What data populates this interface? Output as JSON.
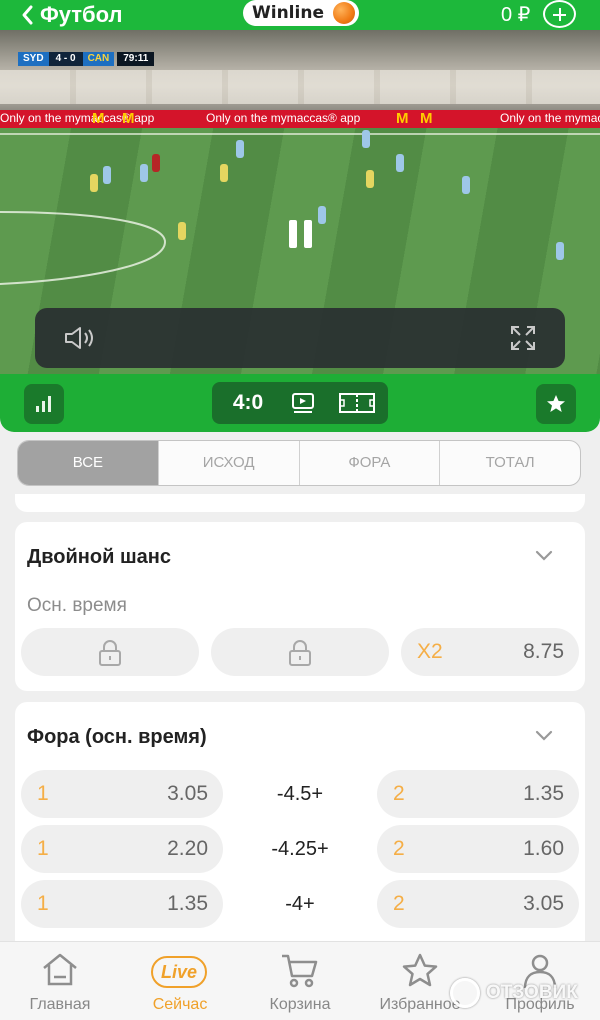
{
  "header": {
    "title": "Футбол",
    "logo_text": "Winline",
    "balance": "0 ₽"
  },
  "video": {
    "scoreboard": {
      "team_home": "SYD",
      "score": "4 - 0",
      "team_away": "CAN",
      "clock": "79:11"
    },
    "ads": [
      "Only on the mymaccas® app",
      "Only on the mymaccas® app",
      "Only on the mymaccas® app"
    ]
  },
  "match_bar": {
    "score": "4:0"
  },
  "tabs": [
    {
      "label": "ВСЕ",
      "active": true
    },
    {
      "label": "ИСХОД",
      "active": false
    },
    {
      "label": "ФОРА",
      "active": false
    },
    {
      "label": "ТОТАЛ",
      "active": false
    }
  ],
  "double_chance": {
    "title": "Двойной шанс",
    "subtitle": "Осн. время",
    "option3_label": "X2",
    "option3_odds": "8.75"
  },
  "handicap": {
    "title": "Фора (осн. время)",
    "rows": [
      {
        "left_label": "1",
        "left_odds": "3.05",
        "line": "-4.5+",
        "right_label": "2",
        "right_odds": "1.35"
      },
      {
        "left_label": "1",
        "left_odds": "2.20",
        "line": "-4.25+",
        "right_label": "2",
        "right_odds": "1.60"
      },
      {
        "left_label": "1",
        "left_odds": "1.35",
        "line": "-4+",
        "right_label": "2",
        "right_odds": "3.05"
      }
    ]
  },
  "bottom_nav": [
    {
      "label": "Главная",
      "icon": "home-icon"
    },
    {
      "label": "Сейчас",
      "icon": "live-icon",
      "badge": "Live",
      "active": true
    },
    {
      "label": "Корзина",
      "icon": "cart-icon"
    },
    {
      "label": "Избранное",
      "icon": "star-icon"
    },
    {
      "label": "Профиль",
      "icon": "profile-icon"
    }
  ],
  "watermark": "ОТЗОВИК",
  "colors": {
    "brand_green": "#1db83b",
    "accent_orange": "#f0a12a"
  }
}
